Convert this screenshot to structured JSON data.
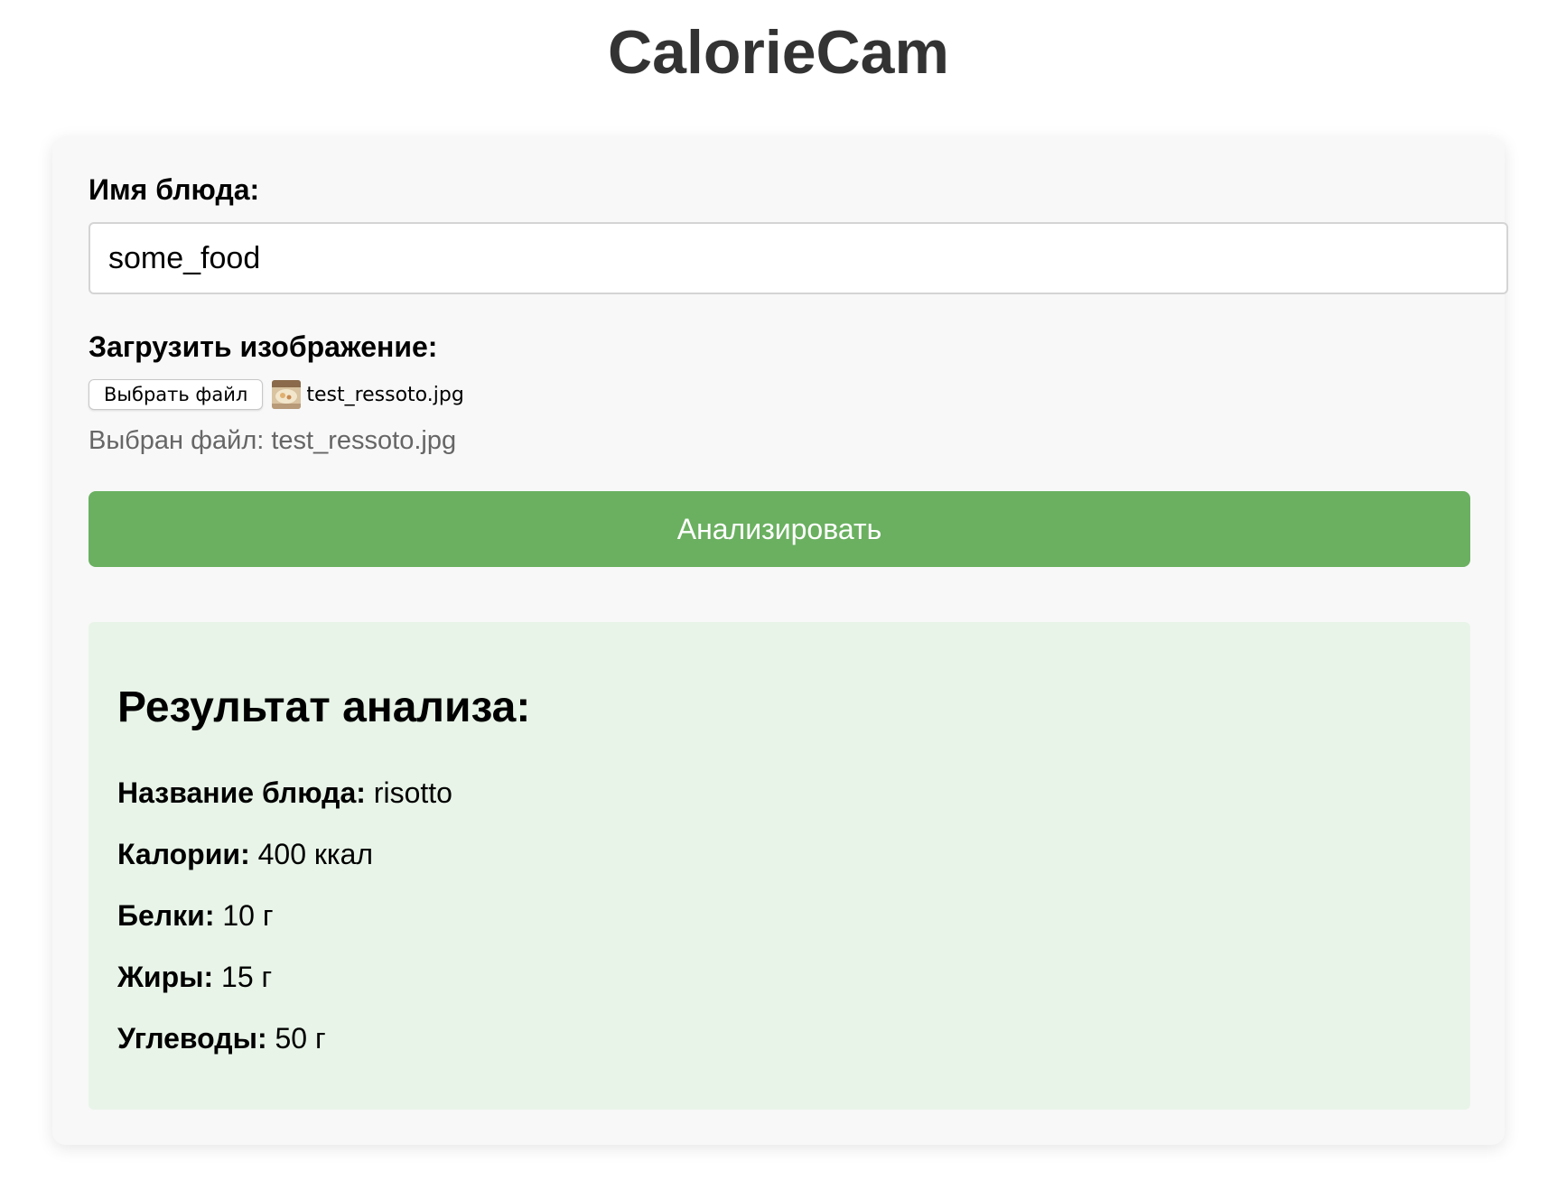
{
  "app": {
    "title": "CalorieCam"
  },
  "form": {
    "dish_name_label": "Имя блюда:",
    "dish_name_value": "some_food",
    "upload_label": "Загрузить изображение:",
    "choose_file_button": "Выбрать файл",
    "file_name": "test_ressoto.jpg",
    "selected_file_text": "Выбран файл: test_ressoto.jpg",
    "analyze_button": "Анализировать"
  },
  "colors": {
    "accent": "#6ab060",
    "result_background": "#e8f4e8",
    "card_background": "#f8f8f8"
  },
  "result": {
    "title": "Результат анализа:",
    "rows": [
      {
        "label": "Название блюда:",
        "value": "risotto"
      },
      {
        "label": "Калории:",
        "value": "400 ккал"
      },
      {
        "label": "Белки:",
        "value": "10 г"
      },
      {
        "label": "Жиры:",
        "value": "15 г"
      },
      {
        "label": "Углеводы:",
        "value": "50 г"
      }
    ]
  }
}
